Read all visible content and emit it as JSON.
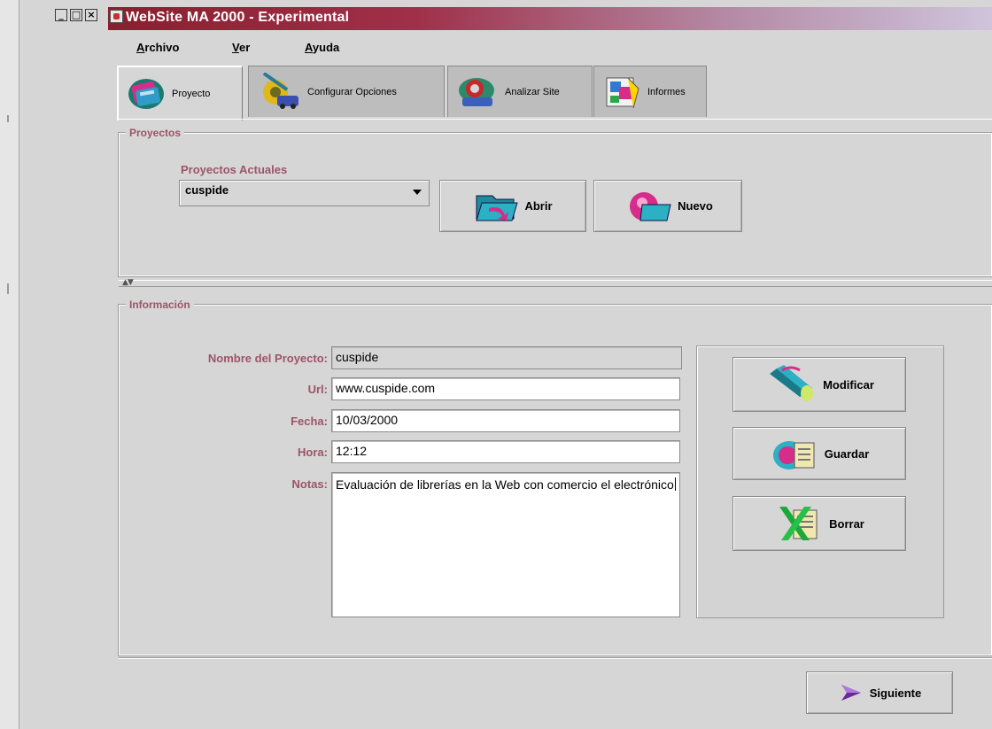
{
  "window": {
    "title": "WebSite MA 2000 - Experimental",
    "controls": [
      "_",
      "□",
      "×"
    ]
  },
  "menu": [
    "Archivo",
    "Ver",
    "Ayuda"
  ],
  "tabs": [
    {
      "label": "Proyecto",
      "icon": "project-icon",
      "active": true
    },
    {
      "label": "Configurar Opciones",
      "icon": "configure-options-icon",
      "active": false
    },
    {
      "label": "Analizar Site",
      "icon": "analyze-site-icon",
      "active": false
    },
    {
      "label": "Informes",
      "icon": "reports-icon",
      "active": false
    }
  ],
  "proyectos": {
    "group_title": "Proyectos",
    "current_label": "Proyectos Actuales",
    "selected": "cuspide",
    "open_label": "Abrir",
    "new_label": "Nuevo"
  },
  "informacion": {
    "group_title": "Información",
    "fields": {
      "nombre": {
        "label": "Nombre del Proyecto:",
        "value": "cuspide"
      },
      "url": {
        "label": "Url:",
        "value": "www.cuspide.com"
      },
      "fecha": {
        "label": "Fecha:",
        "value": "10/03/2000"
      },
      "hora": {
        "label": "Hora:",
        "value": "12:12"
      },
      "notas": {
        "label": "Notas:",
        "value": "Evaluación de librerías en la Web con comercio el electrónico"
      }
    },
    "buttons": {
      "modify": "Modificar",
      "save": "Guardar",
      "delete": "Borrar"
    }
  },
  "next_label": "Siguiente",
  "colors": {
    "title_bar_start": "#8a1f2e",
    "label_color": "#9c5468",
    "background": "#d6d6d6"
  }
}
